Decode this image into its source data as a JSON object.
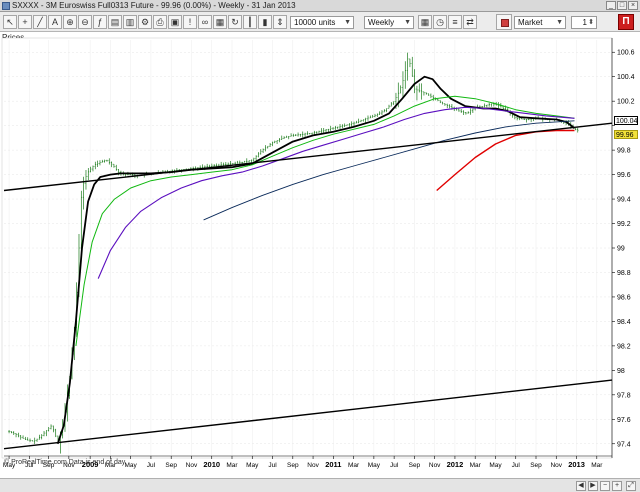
{
  "window": {
    "title": "SXXXX - 3M Euroswiss Full0313 Future - 99.96 (0.00%) - Weekly - 31 Jan 2013"
  },
  "toolbar": {
    "units_value": "10000 units",
    "interval_value": "Weekly",
    "order_type_value": "Market",
    "quantity_value": "1"
  },
  "panel": {
    "prices_label": "Prices"
  },
  "footer": {
    "credit": "© ProRealTime.com  Data is end of day"
  },
  "colors": {
    "price_bars": "#1a7a1a",
    "ma_short": "#000000",
    "ma_green": "#11b811",
    "ma_purple": "#5b0fbf",
    "ma_navy": "#0a2a5a",
    "ma_red": "#e00000",
    "trendline": "#000000",
    "current_price_tag": "#f2e23a",
    "last_value_tag": "#ffffff"
  },
  "chart_data": {
    "type": "line",
    "title": "",
    "xlabel": "",
    "ylabel": "",
    "ylim": [
      97.3,
      100.7
    ],
    "yticks": [
      97.4,
      97.6,
      97.8,
      98,
      98.2,
      98.4,
      98.6,
      98.8,
      99,
      99.2,
      99.4,
      99.6,
      99.8,
      100,
      100.2,
      100.4,
      100.6
    ],
    "ytick_labels": [
      "97.4",
      "97.6",
      "97.8",
      "98",
      "98.2",
      "98.4",
      "98.6",
      "98.8",
      "99",
      "99.2",
      "99.4",
      "99.6",
      "99.8",
      "",
      "100.2",
      "100.4",
      "100.6"
    ],
    "xticks": [
      {
        "t": 0.0,
        "label": "May",
        "bold": false
      },
      {
        "t": 2.0,
        "label": "Jul",
        "bold": false
      },
      {
        "t": 3.9,
        "label": "Sep",
        "bold": false
      },
      {
        "t": 5.9,
        "label": "Nov",
        "bold": false
      },
      {
        "t": 8.0,
        "label": "2009",
        "bold": true
      },
      {
        "t": 10.0,
        "label": "Mar",
        "bold": false
      },
      {
        "t": 12.0,
        "label": "May",
        "bold": false
      },
      {
        "t": 14.0,
        "label": "Jul",
        "bold": false
      },
      {
        "t": 16.0,
        "label": "Sep",
        "bold": false
      },
      {
        "t": 18.0,
        "label": "Nov",
        "bold": false
      },
      {
        "t": 20.0,
        "label": "2010",
        "bold": true
      },
      {
        "t": 22.0,
        "label": "Mar",
        "bold": false
      },
      {
        "t": 24.0,
        "label": "May",
        "bold": false
      },
      {
        "t": 26.0,
        "label": "Jul",
        "bold": false
      },
      {
        "t": 28.0,
        "label": "Sep",
        "bold": false
      },
      {
        "t": 30.0,
        "label": "Nov",
        "bold": false
      },
      {
        "t": 32.0,
        "label": "2011",
        "bold": true
      },
      {
        "t": 34.0,
        "label": "Mar",
        "bold": false
      },
      {
        "t": 36.0,
        "label": "May",
        "bold": false
      },
      {
        "t": 38.0,
        "label": "Jul",
        "bold": false
      },
      {
        "t": 40.0,
        "label": "Sep",
        "bold": false
      },
      {
        "t": 42.0,
        "label": "Nov",
        "bold": false
      },
      {
        "t": 44.0,
        "label": "2012",
        "bold": true
      },
      {
        "t": 46.0,
        "label": "Mar",
        "bold": false
      },
      {
        "t": 48.0,
        "label": "May",
        "bold": false
      },
      {
        "t": 50.0,
        "label": "Jul",
        "bold": false
      },
      {
        "t": 52.0,
        "label": "Sep",
        "bold": false
      },
      {
        "t": 54.0,
        "label": "Nov",
        "bold": false
      },
      {
        "t": 56.0,
        "label": "2013",
        "bold": true
      },
      {
        "t": 58.0,
        "label": "Mar",
        "bold": false
      }
    ],
    "xlim": [
      -0.5,
      59.5
    ],
    "price_value_tag": "99.96",
    "last_value_tag": "100.04",
    "price_value": 99.96,
    "last_value": 100.04,
    "price_path": [
      [
        0,
        97.5
      ],
      [
        0.6,
        97.48
      ],
      [
        1.2,
        97.45
      ],
      [
        1.8,
        97.43
      ],
      [
        2.4,
        97.42
      ],
      [
        3.0,
        97.45
      ],
      [
        3.6,
        97.5
      ],
      [
        4.2,
        97.55
      ],
      [
        4.8,
        97.42
      ],
      [
        5.2,
        97.5
      ],
      [
        5.6,
        97.7
      ],
      [
        6.0,
        97.95
      ],
      [
        6.4,
        98.3
      ],
      [
        6.8,
        98.8
      ],
      [
        7.1,
        99.4
      ],
      [
        7.4,
        99.55
      ],
      [
        7.8,
        99.62
      ],
      [
        8.4,
        99.68
      ],
      [
        9.0,
        99.7
      ],
      [
        9.6,
        99.72
      ],
      [
        10.2,
        99.68
      ],
      [
        10.8,
        99.62
      ],
      [
        11.4,
        99.6
      ],
      [
        12.0,
        99.6
      ],
      [
        12.6,
        99.59
      ],
      [
        13.4,
        99.6
      ],
      [
        14.2,
        99.61
      ],
      [
        15.0,
        99.62
      ],
      [
        16.0,
        99.63
      ],
      [
        17.0,
        99.64
      ],
      [
        18.0,
        99.65
      ],
      [
        19.0,
        99.66
      ],
      [
        20.0,
        99.67
      ],
      [
        21.0,
        99.68
      ],
      [
        22.0,
        99.69
      ],
      [
        23.0,
        99.7
      ],
      [
        24.0,
        99.72
      ],
      [
        25.0,
        99.8
      ],
      [
        26.0,
        99.86
      ],
      [
        27.0,
        99.9
      ],
      [
        28.0,
        99.92
      ],
      [
        29.0,
        99.93
      ],
      [
        30.0,
        99.94
      ],
      [
        31.0,
        99.96
      ],
      [
        32.0,
        99.98
      ],
      [
        33.0,
        100.0
      ],
      [
        34.0,
        100.02
      ],
      [
        35.0,
        100.05
      ],
      [
        36.0,
        100.08
      ],
      [
        37.0,
        100.12
      ],
      [
        38.0,
        100.2
      ],
      [
        38.5,
        100.28
      ],
      [
        39.0,
        100.4
      ],
      [
        39.3,
        100.55
      ],
      [
        39.6,
        100.5
      ],
      [
        40.0,
        100.3
      ],
      [
        40.6,
        100.28
      ],
      [
        41.2,
        100.26
      ],
      [
        42.0,
        100.22
      ],
      [
        42.8,
        100.18
      ],
      [
        43.6,
        100.15
      ],
      [
        44.4,
        100.12
      ],
      [
        45.2,
        100.1
      ],
      [
        46.0,
        100.15
      ],
      [
        46.8,
        100.16
      ],
      [
        47.6,
        100.18
      ],
      [
        48.4,
        100.16
      ],
      [
        49.2,
        100.12
      ],
      [
        50.0,
        100.06
      ],
      [
        51.0,
        100.05
      ],
      [
        52.0,
        100.06
      ],
      [
        53.0,
        100.05
      ],
      [
        54.0,
        100.05
      ],
      [
        55.0,
        100.02
      ],
      [
        55.6,
        99.98
      ],
      [
        56.2,
        99.96
      ]
    ],
    "series": [
      {
        "key": "ma_short",
        "points": [
          [
            4.8,
            97.4
          ],
          [
            5.4,
            97.55
          ],
          [
            6.0,
            97.9
          ],
          [
            6.6,
            98.4
          ],
          [
            7.2,
            99.0
          ],
          [
            7.8,
            99.38
          ],
          [
            8.4,
            99.52
          ],
          [
            9.0,
            99.58
          ],
          [
            10.0,
            99.6
          ],
          [
            11.0,
            99.61
          ],
          [
            12.0,
            99.61
          ],
          [
            14.0,
            99.61
          ],
          [
            16.0,
            99.62
          ],
          [
            18.0,
            99.64
          ],
          [
            20.0,
            99.65
          ],
          [
            22.0,
            99.66
          ],
          [
            24.0,
            99.69
          ],
          [
            26.0,
            99.78
          ],
          [
            28.0,
            99.87
          ],
          [
            30.0,
            99.92
          ],
          [
            32.0,
            99.95
          ],
          [
            34.0,
            99.99
          ],
          [
            36.0,
            100.04
          ],
          [
            37.5,
            100.1
          ],
          [
            38.8,
            100.22
          ],
          [
            40.0,
            100.34
          ],
          [
            41.0,
            100.4
          ],
          [
            41.8,
            100.38
          ],
          [
            42.6,
            100.3
          ],
          [
            43.6,
            100.22
          ],
          [
            45.0,
            100.16
          ],
          [
            46.8,
            100.14
          ],
          [
            48.0,
            100.14
          ],
          [
            49.2,
            100.12
          ],
          [
            50.4,
            100.07
          ],
          [
            52.0,
            100.06
          ],
          [
            54.0,
            100.05
          ],
          [
            55.0,
            100.03
          ],
          [
            55.8,
            99.98
          ]
        ]
      },
      {
        "key": "ma_green",
        "points": [
          [
            6.6,
            98.2
          ],
          [
            7.4,
            98.7
          ],
          [
            8.2,
            99.05
          ],
          [
            9.2,
            99.28
          ],
          [
            10.4,
            99.4
          ],
          [
            12.0,
            99.49
          ],
          [
            14.0,
            99.55
          ],
          [
            16.0,
            99.58
          ],
          [
            18.0,
            99.6
          ],
          [
            20.0,
            99.62
          ],
          [
            22.0,
            99.64
          ],
          [
            24.0,
            99.68
          ],
          [
            26.0,
            99.75
          ],
          [
            28.0,
            99.82
          ],
          [
            30.0,
            99.88
          ],
          [
            32.0,
            99.93
          ],
          [
            34.0,
            99.97
          ],
          [
            36.0,
            100.01
          ],
          [
            38.0,
            100.08
          ],
          [
            40.0,
            100.16
          ],
          [
            42.0,
            100.22
          ],
          [
            44.0,
            100.24
          ],
          [
            46.0,
            100.22
          ],
          [
            48.0,
            100.18
          ],
          [
            50.0,
            100.13
          ],
          [
            52.0,
            100.1
          ],
          [
            54.0,
            100.08
          ],
          [
            55.8,
            100.06
          ]
        ]
      },
      {
        "key": "ma_purple",
        "points": [
          [
            8.8,
            98.75
          ],
          [
            10.0,
            98.98
          ],
          [
            11.5,
            99.17
          ],
          [
            13.0,
            99.3
          ],
          [
            15.0,
            99.41
          ],
          [
            17.0,
            99.49
          ],
          [
            19.0,
            99.55
          ],
          [
            21.0,
            99.59
          ],
          [
            23.0,
            99.62
          ],
          [
            25.0,
            99.67
          ],
          [
            27.0,
            99.73
          ],
          [
            29.0,
            99.79
          ],
          [
            31.0,
            99.84
          ],
          [
            33.0,
            99.89
          ],
          [
            35.0,
            99.94
          ],
          [
            37.0,
            99.99
          ],
          [
            39.0,
            100.05
          ],
          [
            41.0,
            100.1
          ],
          [
            43.0,
            100.13
          ],
          [
            45.0,
            100.15
          ],
          [
            47.0,
            100.14
          ],
          [
            49.0,
            100.12
          ],
          [
            51.0,
            100.1
          ],
          [
            53.0,
            100.08
          ],
          [
            55.8,
            100.06
          ]
        ]
      },
      {
        "key": "ma_navy",
        "points": [
          [
            19.2,
            99.23
          ],
          [
            22.0,
            99.33
          ],
          [
            25.0,
            99.43
          ],
          [
            28.0,
            99.52
          ],
          [
            31.0,
            99.6
          ],
          [
            34.0,
            99.67
          ],
          [
            37.0,
            99.74
          ],
          [
            40.0,
            99.81
          ],
          [
            43.0,
            99.88
          ],
          [
            46.0,
            99.94
          ],
          [
            49.0,
            99.99
          ],
          [
            52.0,
            100.02
          ],
          [
            55.8,
            100.04
          ]
        ]
      },
      {
        "key": "ma_red",
        "points": [
          [
            42.2,
            99.47
          ],
          [
            44.0,
            99.6
          ],
          [
            46.0,
            99.74
          ],
          [
            48.0,
            99.85
          ],
          [
            50.0,
            99.92
          ],
          [
            52.0,
            99.95
          ],
          [
            54.0,
            99.96
          ],
          [
            55.8,
            99.96
          ]
        ]
      },
      {
        "key": "trendline",
        "points": [
          [
            -0.5,
            99.47
          ],
          [
            59.5,
            100.02
          ]
        ]
      },
      {
        "key": "trendline",
        "points": [
          [
            -0.5,
            97.36
          ],
          [
            59.5,
            97.92
          ]
        ]
      }
    ]
  }
}
